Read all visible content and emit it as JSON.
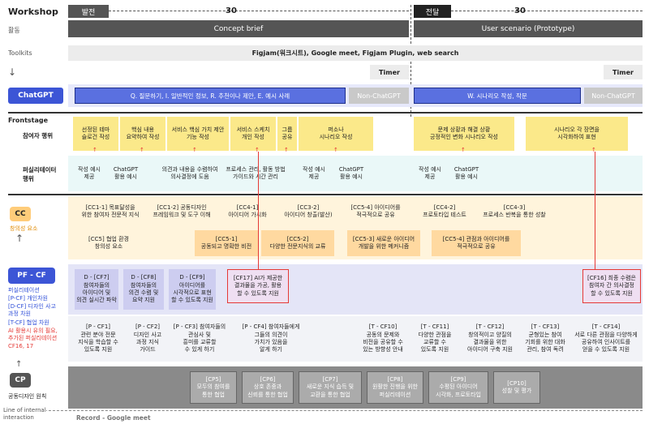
{
  "header": {
    "workshop": "Workshop",
    "phase1": "발전",
    "phase1_time": "30",
    "phase2": "전달",
    "phase2_time": "30"
  },
  "activity": {
    "label": "활동",
    "left": "Concept brief",
    "right": "User scenario (Prototype)"
  },
  "toolkits": {
    "label": "Toolkits",
    "text": "Figjam(워크시트), Google meet, Figjam Plugin, web search",
    "timer_left": "Timer",
    "timer_right": "Timer"
  },
  "chatgpt": {
    "label": "ChatGPT",
    "left": "Q. 질문하기, I. 일반적인 정보, R. 추천이나 제안, E. 예시 사례",
    "non_left": "Non-ChatGPT",
    "right": "W. 시나리오 작성, 작문",
    "non_right": "Non-ChatGPT"
  },
  "frontstage": {
    "label": "Frontstage",
    "participant_label": "참여자 행위",
    "participant_cells": [
      "선정된 테마\n슬로건 작성",
      "핵심 내용\n요약하여 작성",
      "서비스 핵심 가치 제안\n기능 작성",
      "서비스 스케치\n개인 작성",
      "그룹\n공유",
      "퍼소나\n시나리오 작성",
      "문제 상황과 해결 상황\n긍정적인 변화 시나리오 작성",
      "시나리오 각 장면을\n시각화하여 표현"
    ],
    "facilitator_label": "퍼실리테이터\n행위",
    "facilitator_cells": [
      "작성 예시\n제공",
      "ChatGPT\n활용 예시",
      "의견과 내용을 수렴하여\n의사결정에 도움",
      "프로세스 관리, 활동 방법\n가이드와 시간 관리",
      "작성 예시\n제공",
      "ChatGPT\n활용 예시",
      "작성 예시\n제공",
      "ChatGPT\n활용 예시"
    ]
  },
  "cc": {
    "badge": "CC",
    "label": "창의성 요소",
    "row1": [
      "[CC1-1] 목표달성을\n위한 참여자 전문적 지식",
      "[CC1-2] 공동디자인\n프레임워크 및 도구 이해",
      "[CC4-1]\n아이디어 가시화",
      "[CC3-2]\n아이디어 창출(발산)",
      "[CC5-4] 아이디어를\n적극적으로 공유",
      "[CC4-2]\n프로토타입 테스트",
      "[CC4-3]\n프로세스 반복을 통한 성찰"
    ],
    "row2": [
      "[CC5] 협업 환경\n창의성 요소",
      "[CC5-1]\n공동되고 명확한 비전",
      "[CC5-2]\n다양한 전문지식의 교류",
      "[CC5-3] 새로운 아이디어\n개발을 위한 메커니즘",
      "[CC5-4] 관점과 아이디어를\n적극적으로 공유"
    ]
  },
  "pfcf": {
    "badge": "PF - CF",
    "legend": [
      "퍼실리테이션",
      "[P-CF] 개인차원",
      "[D-CF] 디자인 사고\n과정 차원",
      "[T-CF] 협업 차원",
      "AI 활용시 유의 필요,\n추가된 퍼실리테이션\nCF16, 17"
    ],
    "d_boxes": [
      "D - [CF7]\n참여자들의\n아이디어 및\n의견 실시간 파악",
      "D - [CF8]\n참여자들의\n의견 수렴 및\n요약 지원",
      "D - [CF9]\n아이디어를\n시각적으로 표현\n할 수 있도록 지원"
    ],
    "cf17": "[CF17] AI가 제공한\n결과물을 가공, 활용\n할 수 있도록 지원",
    "cf16": "[CF16] 최종 수렴은\n참여자 간 의사결정\n할 수 있도록 지원",
    "p_boxes": [
      "[P - CF1]\n관련 분야 전문\n지식을 학습할 수\n있도록 지원",
      "[P - CF2]\n디자인 사고\n과정 지식\n가이드",
      "[P - CF3] 참여자들의\n관심사 및\n흥미를 교류할\n수 있게 하기",
      "[P - CF4] 참여자들에게\n그들의 의견이\n가치가 있음을\n알게 하기"
    ],
    "t_boxes": [
      "[T - CF10]\n공동의 문제와\n비전을 공유할 수\n있는 방향성 안내",
      "[T - CF11]\n다양한 관점을\n교류할 수\n있도록 지원",
      "[T - CF12]\n창의적이고 양질의\n결과물을 위한\n아이디어 구축 지원",
      "[T - CF13]\n균형있는 참여\n기회를 위한 대화\n관리, 참여 독려",
      "[T - CF14]\n서로 다른 관점을 다양하게\n공유하여 인사이트를\n얻을 수 있도록 지원"
    ]
  },
  "cp": {
    "badge": "CP",
    "label": "공동디자인 원칙",
    "boxes": [
      "[CP5]\n모두의 참여를\n통한 협업",
      "[CP6]\n상호 존중과\n신뢰를 통한 협업",
      "[CP7]\n새로운 지식 습득 및\n교환을 통한 협업",
      "[CP8]\n원활한 진행을 위한\n퍼실리테이션",
      "[CP9]\n수평된 아이디어\n시각화, 프로토타입",
      "[CP10]\n성찰 및 평가"
    ]
  },
  "footer": {
    "line_label": "Line of internal\ninteraction",
    "record": "Record - Google meet"
  },
  "colors": {
    "chatgpt_blue": "#3c55d6",
    "participant_yellow": "#fbe98a",
    "cc_orange": "#ffd9a0",
    "pf_lavender": "#cdcdf0",
    "accent_red": "#e53935"
  }
}
